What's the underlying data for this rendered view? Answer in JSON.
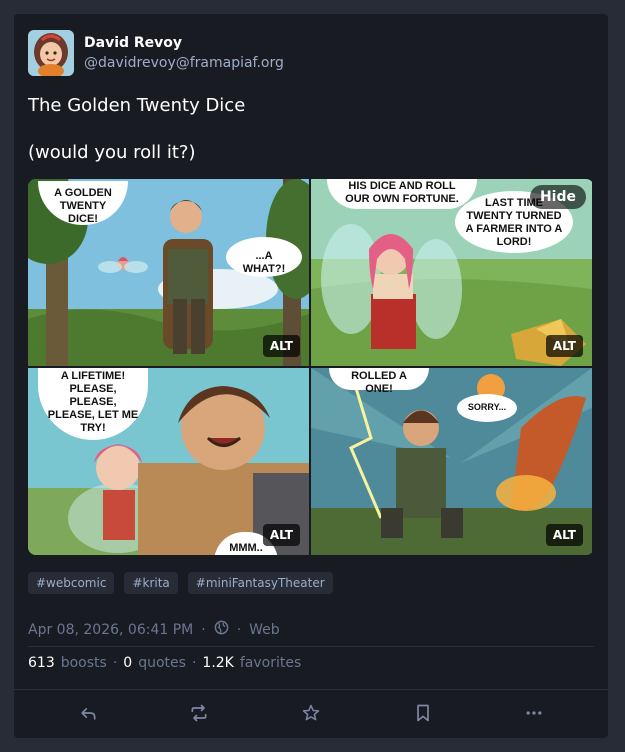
{
  "author": {
    "display_name": "David Revoy",
    "handle": "@davidrevoy@framapiaf.org"
  },
  "post": {
    "title": "The Golden Twenty Dice",
    "subtitle": "(would you roll it?)"
  },
  "media": {
    "hide_label": "Hide",
    "alt_label": "ALT",
    "panels": [
      {
        "bubbles": [
          "A GOLDEN TWENTY DICE!",
          "...A WHAT?!"
        ]
      },
      {
        "bubbles": [
          "HIS DICE AND ROLL OUR OWN FORTUNE.",
          "LAST TIME TWENTY TURNED A FARMER INTO A LORD!"
        ]
      },
      {
        "bubbles": [
          "A LIFETIME! PLEASE, PLEASE, PLEASE, LET ME TRY!",
          "MMM.. OK."
        ]
      },
      {
        "bubbles": [
          "ROLLED A ONE!",
          "SORRY..."
        ]
      }
    ]
  },
  "tags": [
    "#webcomic",
    "#krita",
    "#miniFantasyTheater"
  ],
  "meta": {
    "date": "Apr 08, 2026, 06:41 PM",
    "separator": "·",
    "visibility_icon": "globe-icon",
    "client": "Web"
  },
  "stats": {
    "boosts_count": "613",
    "boosts_label": "boosts",
    "quotes_count": "0",
    "quotes_label": "quotes",
    "favorites_count": "1.2K",
    "favorites_label": "favorites",
    "separator": "·"
  },
  "actions": [
    "reply-icon",
    "boost-icon",
    "favorite-icon",
    "bookmark-icon",
    "more-icon"
  ],
  "colors": {
    "background": "#282c37",
    "card": "#191b22",
    "muted": "#6a7792",
    "link": "#9baec8"
  }
}
